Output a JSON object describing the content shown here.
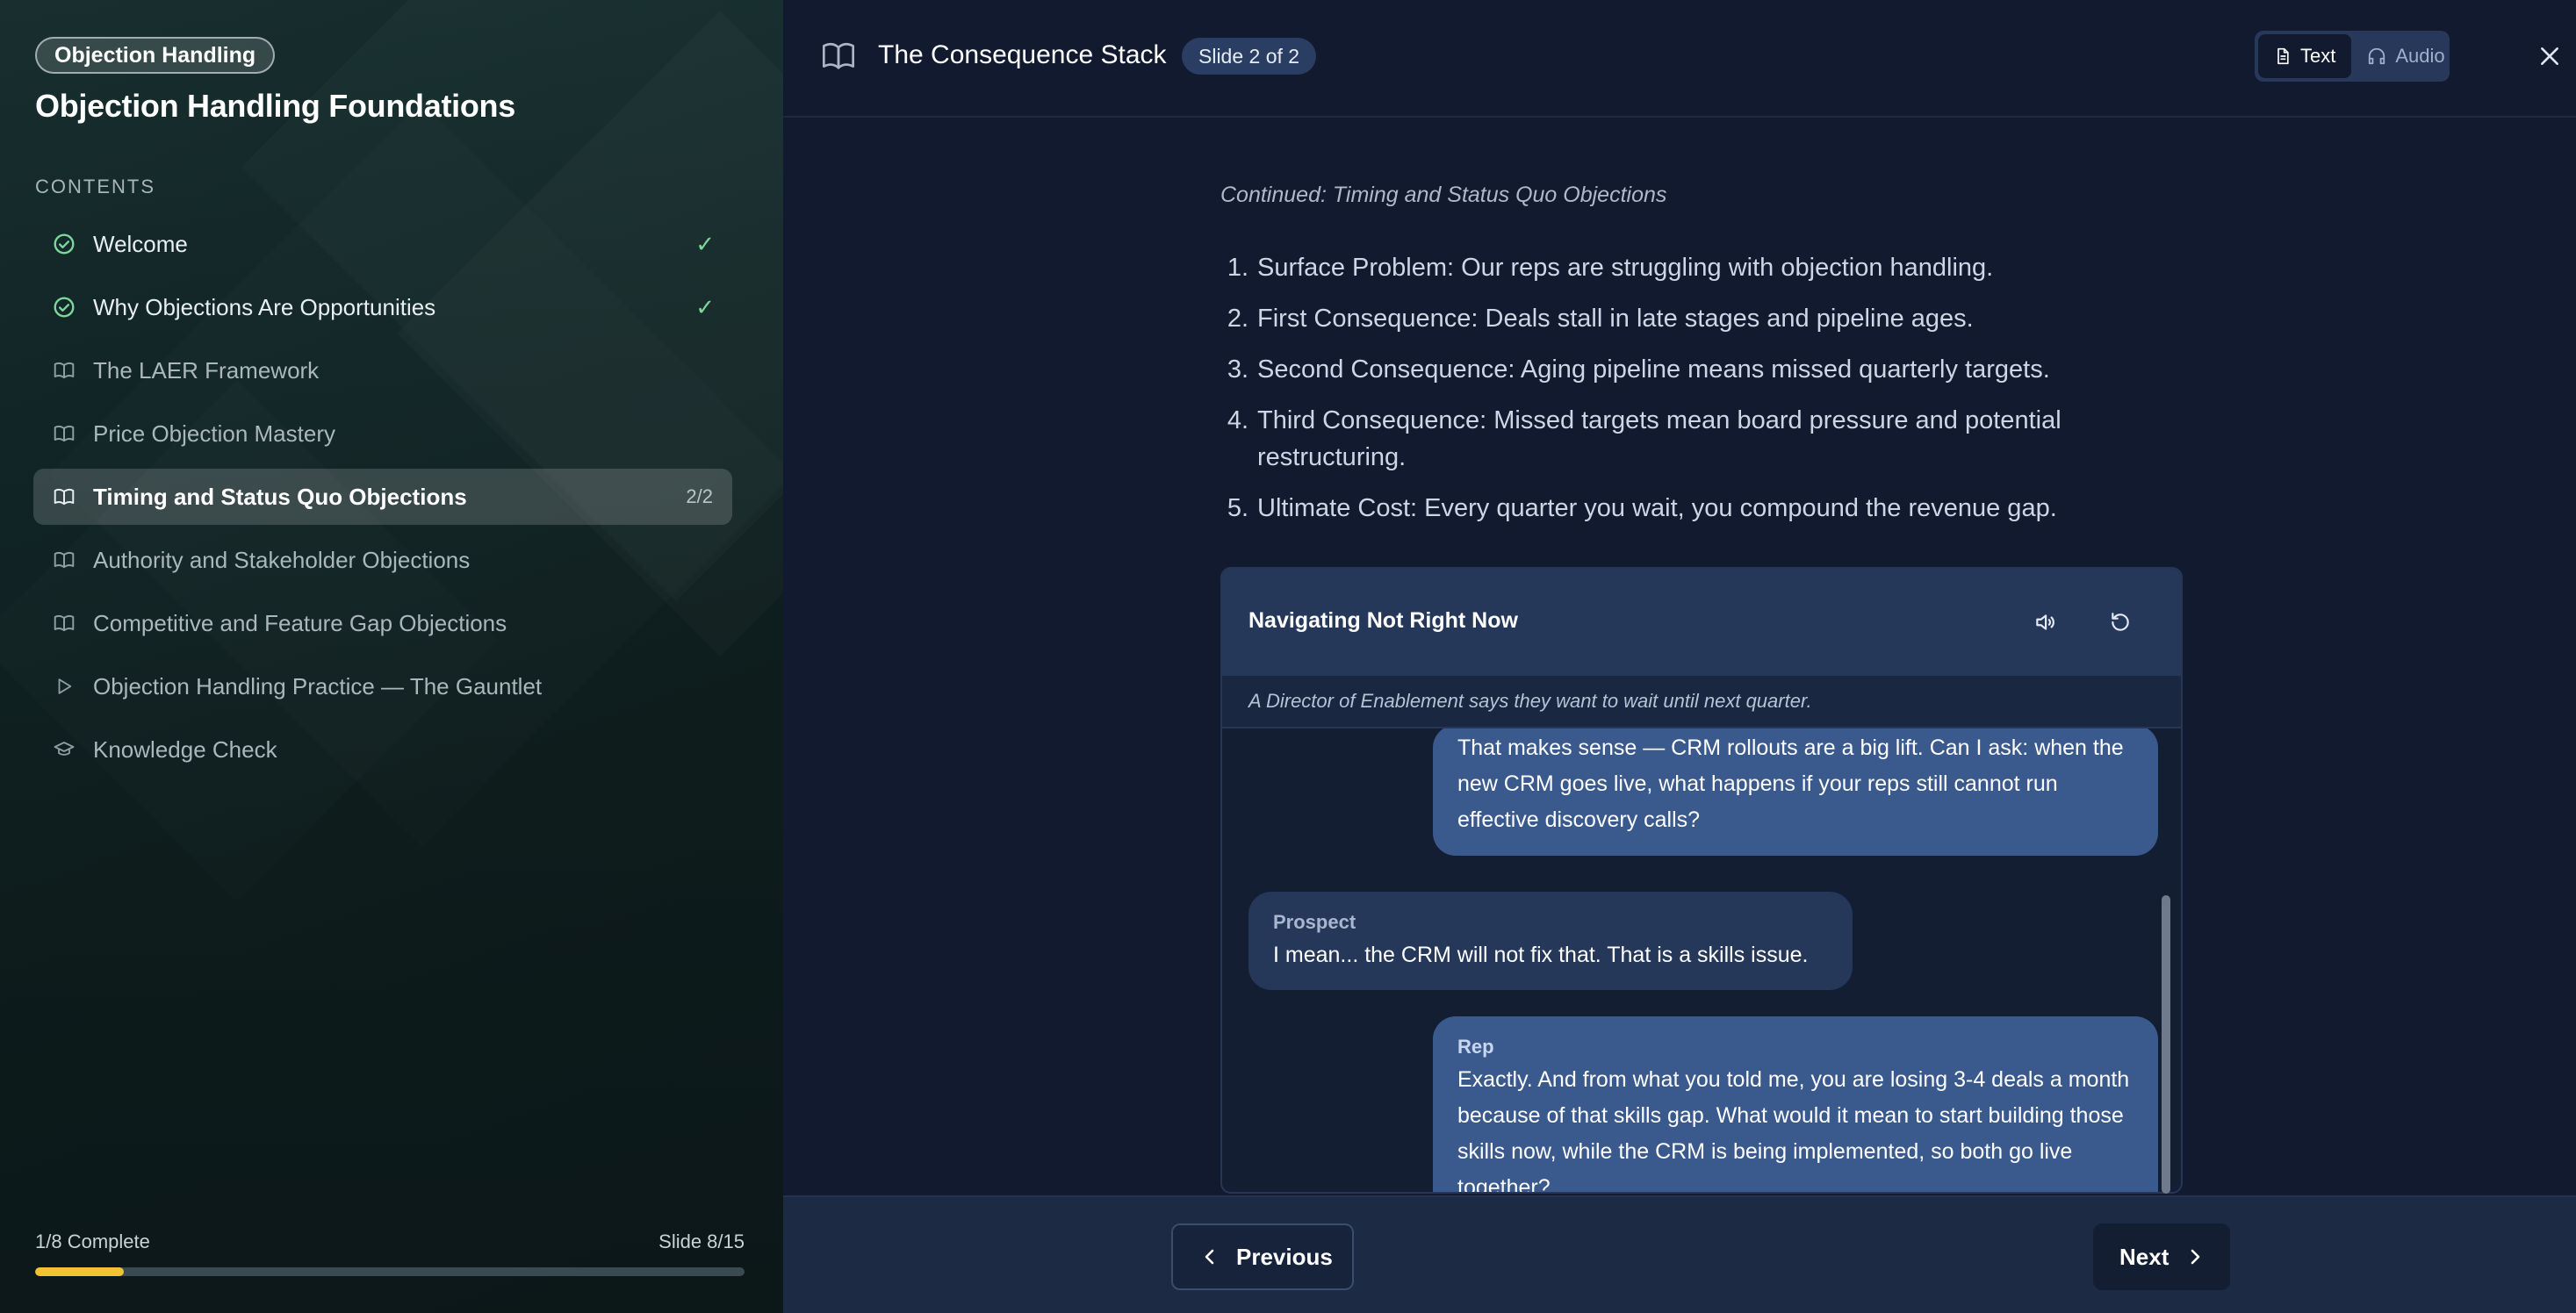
{
  "sidebar": {
    "course_badge": "Objection Handling",
    "course_title": "Objection Handling Foundations",
    "contents_label": "CONTENTS",
    "items": [
      {
        "label": "Welcome",
        "icon": "check-circle-icon",
        "status": "done",
        "right": "✓"
      },
      {
        "label": "Why Objections Are Opportunities",
        "icon": "check-circle-icon",
        "status": "done",
        "right": "✓"
      },
      {
        "label": "The LAER Framework",
        "icon": "book-icon",
        "status": "pending",
        "right": ""
      },
      {
        "label": "Price Objection Mastery",
        "icon": "book-icon",
        "status": "pending",
        "right": ""
      },
      {
        "label": "Timing and Status Quo Objections",
        "icon": "book-icon",
        "status": "active",
        "right": "2/2"
      },
      {
        "label": "Authority and Stakeholder Objections",
        "icon": "book-icon",
        "status": "pending",
        "right": ""
      },
      {
        "label": "Competitive and Feature Gap Objections",
        "icon": "book-icon",
        "status": "pending",
        "right": ""
      },
      {
        "label": "Objection Handling Practice — The Gauntlet",
        "icon": "play-icon",
        "status": "pending",
        "right": ""
      },
      {
        "label": "Knowledge Check",
        "icon": "graduation-cap-icon",
        "status": "pending",
        "right": ""
      }
    ],
    "progress": {
      "complete_text": "1/8 Complete",
      "slide_text": "Slide 8/15",
      "fraction": 0.125
    }
  },
  "header": {
    "title": "The Consequence Stack",
    "slide_badge": "Slide 2 of 2",
    "toggle": {
      "text_label": "Text",
      "audio_label": "Audio",
      "selected": "Text"
    }
  },
  "content": {
    "continued": "Continued: Timing and Status Quo Objections",
    "steps": [
      {
        "num": "1.",
        "text": "Surface Problem: Our reps are struggling with objection handling."
      },
      {
        "num": "2.",
        "text": "First Consequence: Deals stall in late stages and pipeline ages."
      },
      {
        "num": "3.",
        "text": "Second Consequence: Aging pipeline means missed quarterly targets."
      },
      {
        "num": "4.",
        "text": "Third Consequence: Missed targets mean board pressure and potential restructuring."
      },
      {
        "num": "5.",
        "text": "Ultimate Cost: Every quarter you wait, you compound the revenue gap."
      }
    ]
  },
  "dialogue": {
    "title": "Navigating Not Right Now",
    "subtitle": "A Director of Enablement says they want to wait until next quarter.",
    "messages": [
      {
        "speaker": "",
        "text": "That makes sense — CRM rollouts are a big lift. Can I ask: when the new CRM goes live, what happens if your reps still cannot run effective discovery calls?"
      },
      {
        "speaker": "Prospect",
        "text": "I mean... the CRM will not fix that. That is a skills issue."
      },
      {
        "speaker": "Rep",
        "text": "Exactly. And from what you told me, you are losing 3-4 deals a month because of that skills gap. What would it mean to start building those skills now, while the CRM is being implemented, so both go live together?"
      }
    ]
  },
  "footer": {
    "previous_label": "Previous",
    "next_label": "Next"
  },
  "colors": {
    "accent_progress": "#f3c234",
    "check_green": "#7dd69a",
    "rep_bubble": "#3a5a8e",
    "prospect_bubble": "#25385a"
  }
}
